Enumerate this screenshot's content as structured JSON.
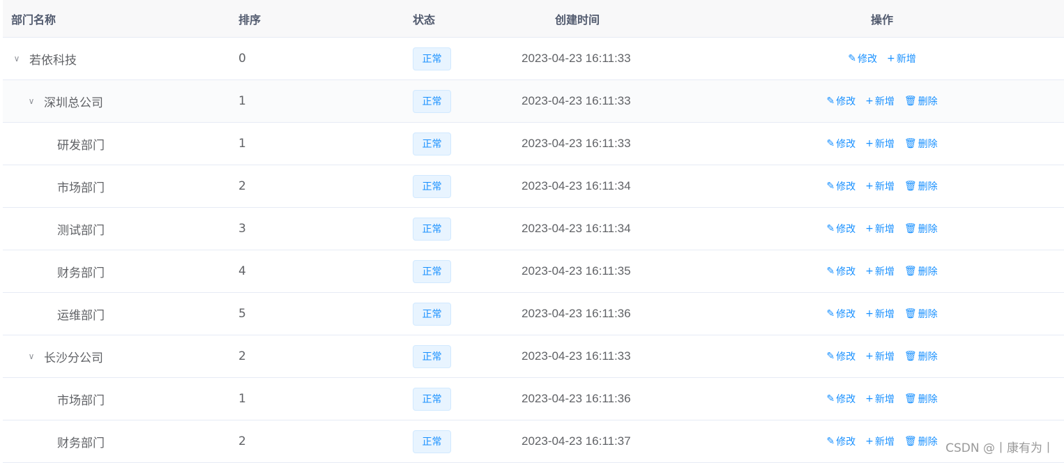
{
  "headers": {
    "name": "部门名称",
    "sort": "排序",
    "status": "状态",
    "time": "创建时间",
    "ops": "操作"
  },
  "ops": {
    "edit": "修改",
    "add": "新增",
    "delete": "删除"
  },
  "rows": [
    {
      "name": "若依科技",
      "sort": "0",
      "status": "正常",
      "time": "2023-04-23 16:11:33"
    },
    {
      "name": "深圳总公司",
      "sort": "1",
      "status": "正常",
      "time": "2023-04-23 16:11:33"
    },
    {
      "name": "研发部门",
      "sort": "1",
      "status": "正常",
      "time": "2023-04-23 16:11:33"
    },
    {
      "name": "市场部门",
      "sort": "2",
      "status": "正常",
      "time": "2023-04-23 16:11:34"
    },
    {
      "name": "测试部门",
      "sort": "3",
      "status": "正常",
      "time": "2023-04-23 16:11:34"
    },
    {
      "name": "财务部门",
      "sort": "4",
      "status": "正常",
      "time": "2023-04-23 16:11:35"
    },
    {
      "name": "运维部门",
      "sort": "5",
      "status": "正常",
      "time": "2023-04-23 16:11:36"
    },
    {
      "name": "长沙分公司",
      "sort": "2",
      "status": "正常",
      "time": "2023-04-23 16:11:33"
    },
    {
      "name": "市场部门",
      "sort": "1",
      "status": "正常",
      "time": "2023-04-23 16:11:36"
    },
    {
      "name": "财务部门",
      "sort": "2",
      "status": "正常",
      "time": "2023-04-23 16:11:37"
    }
  ],
  "watermark": "CSDN @丨康有为丨",
  "colors": {
    "accent": "#1890ff",
    "tag_bg": "#e8f4ff",
    "header_bg": "#f8f8f9"
  },
  "icons": {
    "edit": "edit-icon",
    "add": "plus-icon",
    "delete": "delete-icon",
    "expand": "chevron-down-icon"
  }
}
